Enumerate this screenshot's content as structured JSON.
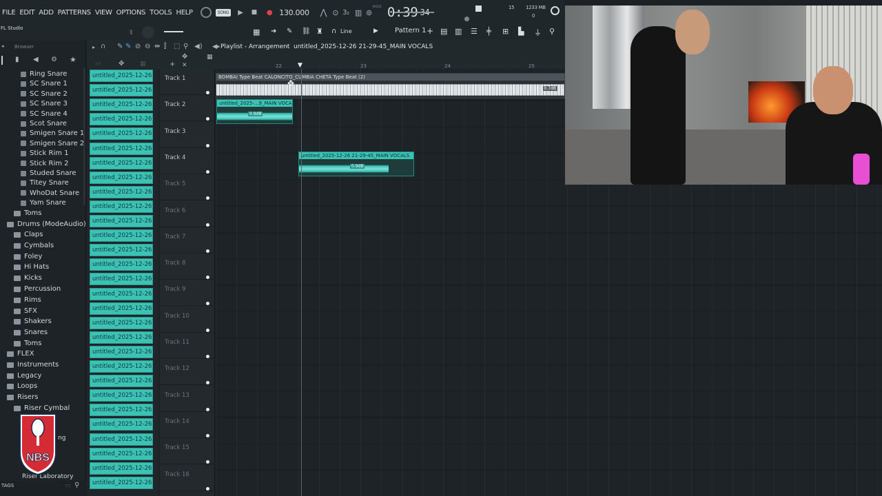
{
  "menu": {
    "items": [
      "FILE",
      "EDIT",
      "ADD",
      "PATTERNS",
      "VIEW",
      "OPTIONS",
      "TOOLS",
      "HELP"
    ]
  },
  "transport": {
    "mode": "SONG",
    "tempo": "130.000",
    "time": "0:39",
    "time_small": "34",
    "time_label": "M:S:CS",
    "cpu": "15",
    "mem": "1233 MB",
    "mem2": "0"
  },
  "toolbar2": {
    "app_label": "FL Studio",
    "line_label": "Line",
    "pattern": "Pattern 1"
  },
  "browser": {
    "title": "Browser",
    "items": [
      "Ring Snare",
      "SC Snare 1",
      "SC Snare 2",
      "SC Snare 3",
      "SC Snare 4",
      "Scot Snare",
      "Smigen Snare 1",
      "Smigen Snare 2",
      "Stick Rim 1",
      "Stick Rim 2",
      "Studed Snare",
      "Titey Snare",
      "WhoDat Snare",
      "Yam Snare"
    ],
    "folders": [
      "Toms",
      "Drums (ModeAudio)",
      "Claps",
      "Cymbals",
      "Foley",
      "Hi Hats",
      "Kicks",
      "Percussion",
      "Rims",
      "SFX",
      "Shakers",
      "Snares",
      "Toms",
      "FLEX",
      "Instruments",
      "Legacy",
      "Loops",
      "Risers",
      "Riser Cymbal"
    ],
    "partial_items": [
      "ng",
      "Riser Laboratory"
    ],
    "tags": "TAGS"
  },
  "picker": {
    "clip_label": "untitled_2025-12-26 21-..."
  },
  "playlist": {
    "title": "Playlist - Arrangement",
    "breadcrumb": "untitled_2025-12-26 21-29-45_MAIN VOCALS",
    "ruler": [
      "22",
      "23",
      "24",
      "25"
    ],
    "tracks": [
      "Track 1",
      "Track 2",
      "Track 3",
      "Track 4",
      "Track 5",
      "Track 6",
      "Track 7",
      "Track 8",
      "Track 9",
      "Track 10",
      "Track 11",
      "Track 12",
      "Track 13",
      "Track 14",
      "Track 15",
      "Track 16"
    ],
    "clips": [
      {
        "label": "BOMBAI Type Beat CALONCITO_CUMBIA CHETA Type Beat (2)",
        "color": "#e8ecef"
      },
      {
        "label": "untitled_2025-...9_MAIN VOCALS",
        "gain": "0.9dB",
        "color": "#3cc2b5"
      },
      {
        "label": "untitled_2025-12-26 21-29-45_MAIN VOCALS",
        "gain": "0.9dB",
        "color": "#3cc2b5"
      }
    ],
    "clip1_tag": "0.7dB"
  },
  "colors": {
    "accent": "#3cc2b5",
    "record": "#e0424a",
    "background": "#1b2125"
  },
  "logo": {
    "text": "NBS"
  }
}
